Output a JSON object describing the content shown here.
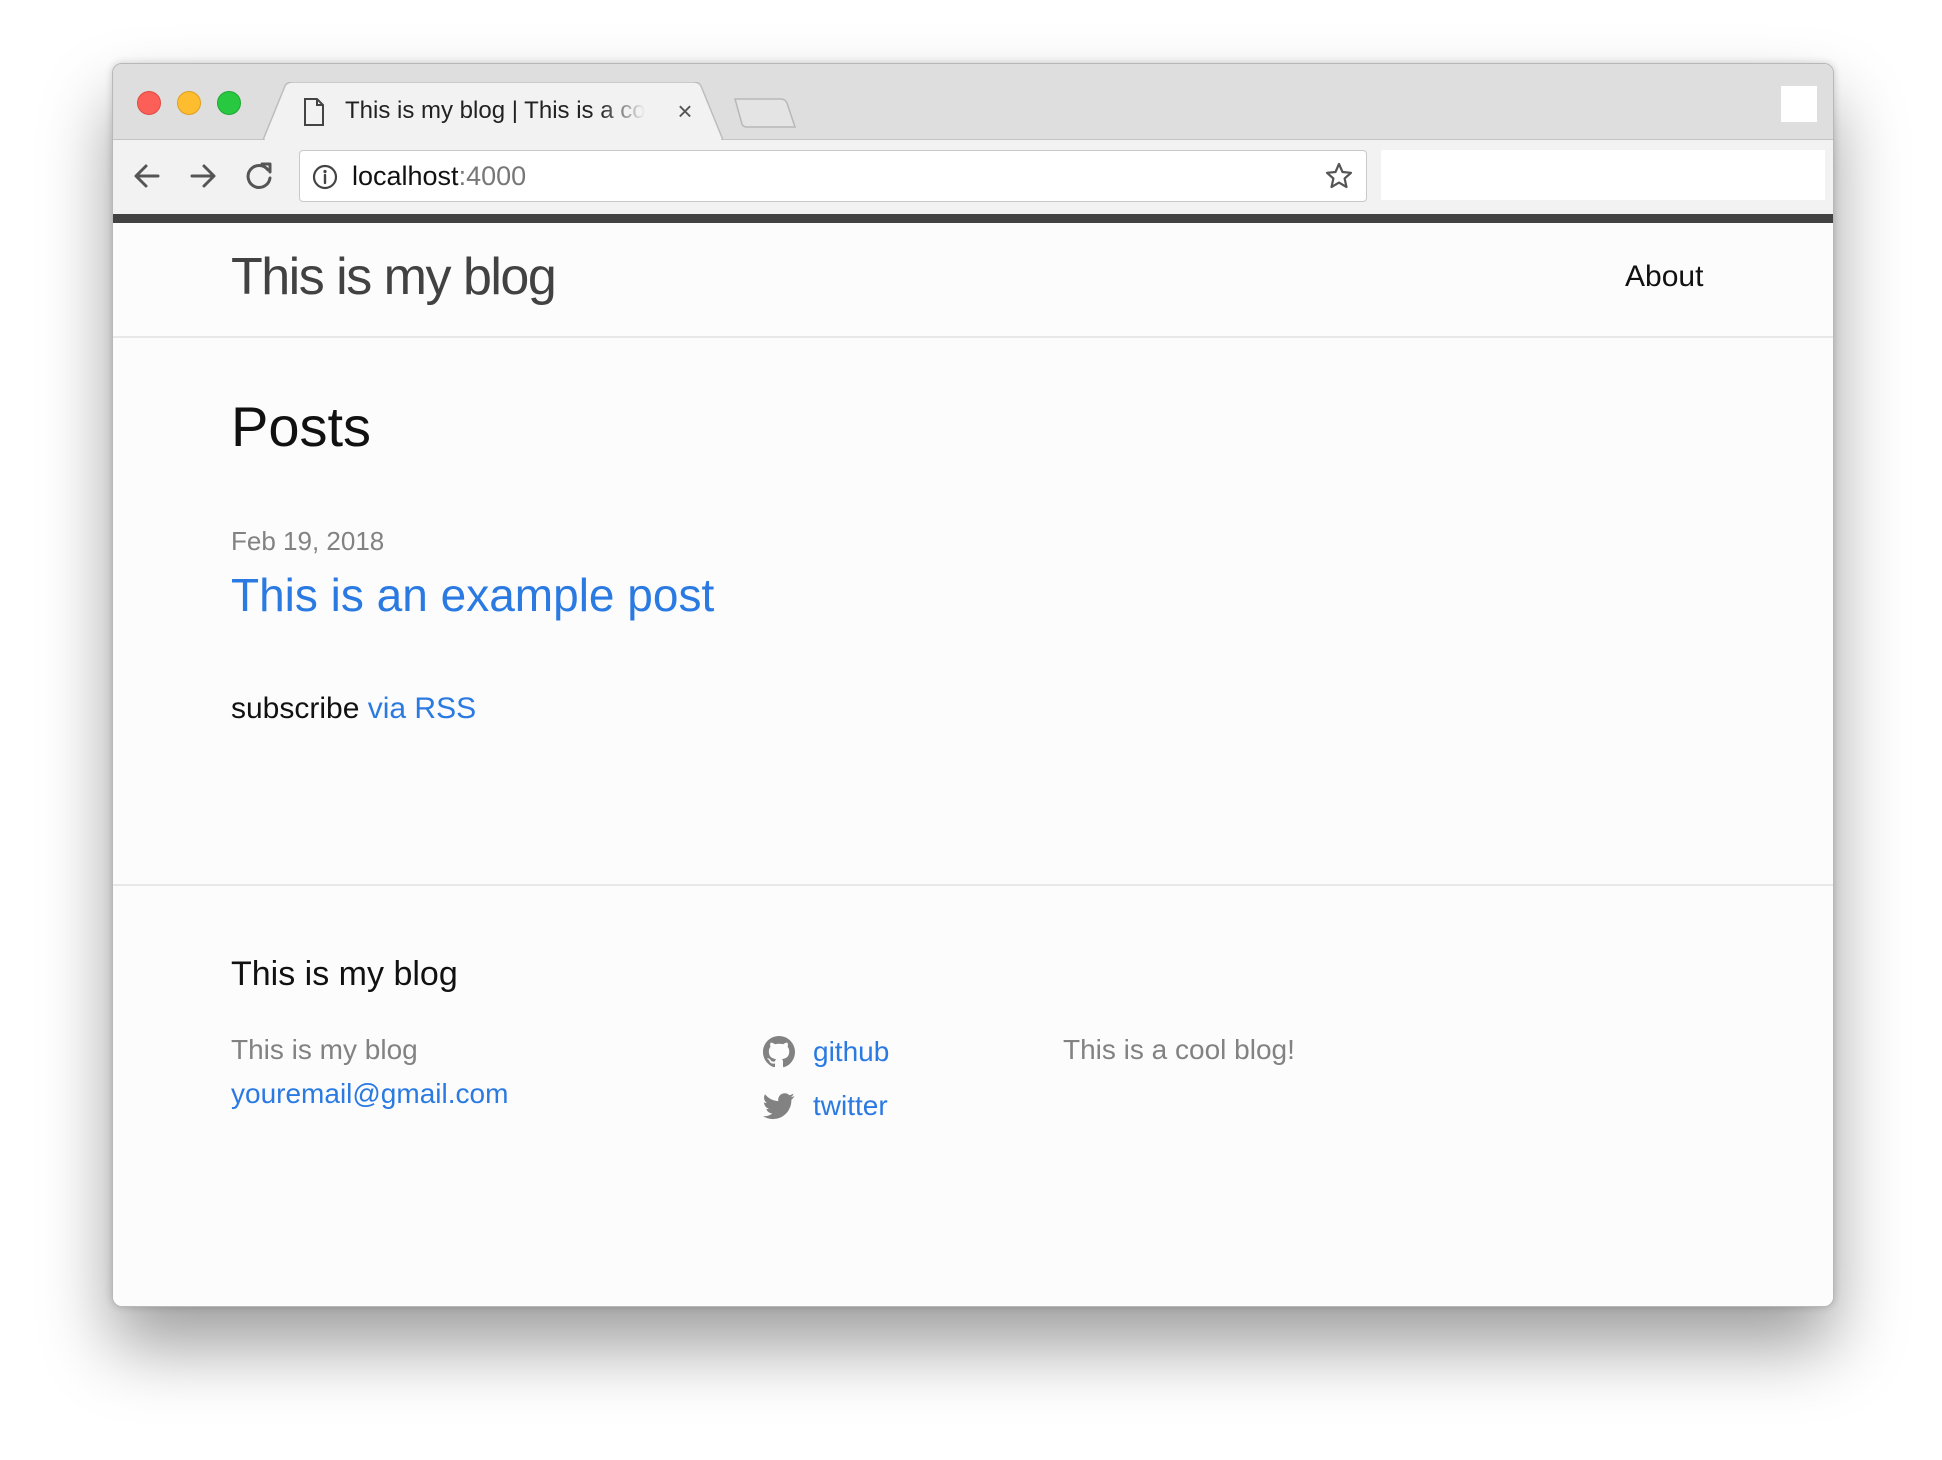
{
  "browser": {
    "tab_title": "This is my blog | This is a cool blog!",
    "tab_close": "×",
    "url_host": "localhost",
    "url_port": ":4000"
  },
  "site": {
    "title": "This is my blog",
    "nav": {
      "about": "About"
    }
  },
  "main": {
    "heading": "Posts",
    "posts": [
      {
        "date": "Feb 19, 2018",
        "title": "This is an example post"
      }
    ],
    "subscribe_text": "subscribe ",
    "subscribe_link": "via RSS"
  },
  "footer": {
    "heading": "This is my blog",
    "name": "This is my blog",
    "email": "youremail@gmail.com",
    "social": [
      {
        "icon": "github-icon",
        "label": "github"
      },
      {
        "icon": "twitter-icon",
        "label": "twitter"
      }
    ],
    "description": "This is a cool blog!"
  },
  "colors": {
    "link": "#2a7ae2",
    "muted": "#828282",
    "header_bar": "#424242"
  }
}
